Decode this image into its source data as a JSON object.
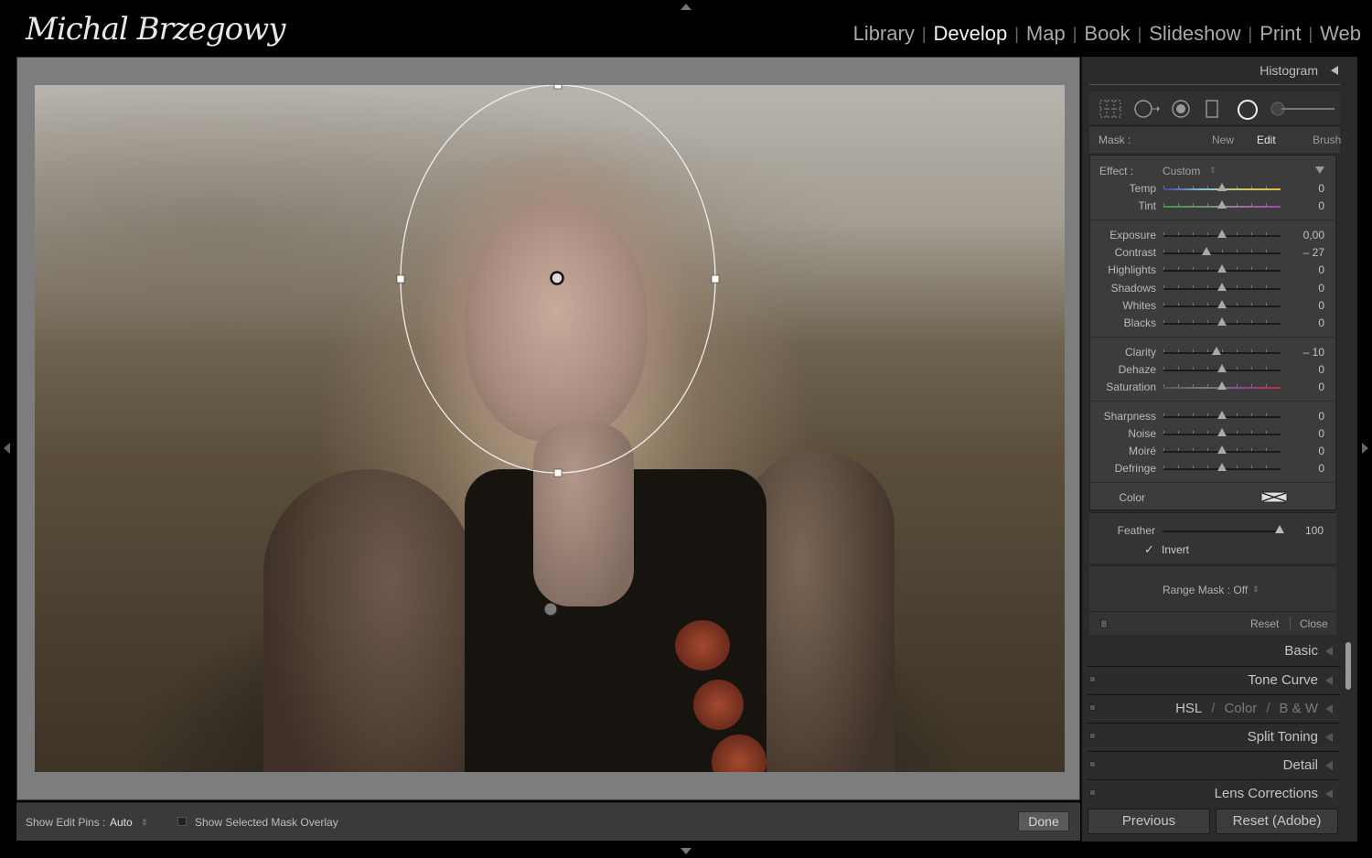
{
  "identity_plate": "Michal Brzegowy",
  "modules": [
    {
      "label": "Library",
      "active": false
    },
    {
      "label": "Develop",
      "active": true
    },
    {
      "label": "Map",
      "active": false
    },
    {
      "label": "Book",
      "active": false
    },
    {
      "label": "Slideshow",
      "active": false
    },
    {
      "label": "Print",
      "active": false
    },
    {
      "label": "Web",
      "active": false
    }
  ],
  "module_separator": "|",
  "toolbar": {
    "show_edit_pins_label": "Show Edit Pins :",
    "show_edit_pins_value": "Auto",
    "show_mask_overlay_label": "Show Selected Mask Overlay",
    "done_label": "Done"
  },
  "histogram": {
    "title": "Histogram"
  },
  "tools": [
    "crop-overlay-icon",
    "spot-removal-icon",
    "red-eye-icon",
    "graduated-filter-icon",
    "radial-filter-icon",
    "adjustment-brush-icon"
  ],
  "mask": {
    "label": "Mask :",
    "new": "New",
    "edit": "Edit",
    "brush": "Brush"
  },
  "effect": {
    "label": "Effect :",
    "value": "Custom"
  },
  "sliders": {
    "group1": [
      {
        "name": "Temp",
        "value": "0",
        "pos": 0.5
      },
      {
        "name": "Tint",
        "value": "0",
        "pos": 0.5
      }
    ],
    "group2": [
      {
        "name": "Exposure",
        "value": "0,00",
        "pos": 0.5
      },
      {
        "name": "Contrast",
        "value": "– 27",
        "pos": 0.37
      },
      {
        "name": "Highlights",
        "value": "0",
        "pos": 0.5
      },
      {
        "name": "Shadows",
        "value": "0",
        "pos": 0.5
      },
      {
        "name": "Whites",
        "value": "0",
        "pos": 0.5
      },
      {
        "name": "Blacks",
        "value": "0",
        "pos": 0.5
      }
    ],
    "group3": [
      {
        "name": "Clarity",
        "value": "– 10",
        "pos": 0.45
      },
      {
        "name": "Dehaze",
        "value": "0",
        "pos": 0.5
      },
      {
        "name": "Saturation",
        "value": "0",
        "pos": 0.5
      }
    ],
    "group4": [
      {
        "name": "Sharpness",
        "value": "0",
        "pos": 0.5
      },
      {
        "name": "Noise",
        "value": "0",
        "pos": 0.5
      },
      {
        "name": "Moiré",
        "value": "0",
        "pos": 0.5
      },
      {
        "name": "Defringe",
        "value": "0",
        "pos": 0.5
      }
    ]
  },
  "color_label": "Color",
  "feather": {
    "label": "Feather",
    "value": "100",
    "pos": 1.0
  },
  "invert": {
    "label": "Invert",
    "checked": true,
    "mark": "✓"
  },
  "range_mask": {
    "label": "Range Mask : Off"
  },
  "reset_label": "Reset",
  "close_label": "Close",
  "panels": {
    "basic": "Basic",
    "tone_curve": "Tone Curve",
    "hsl": "HSL",
    "hsl_sep": "/",
    "color": "Color",
    "bw": "B & W",
    "split_toning": "Split Toning",
    "detail": "Detail",
    "lens_corrections": "Lens Corrections"
  },
  "buttons": {
    "previous": "Previous",
    "reset_adobe": "Reset (Adobe)"
  },
  "colors": {
    "accent_text": "#f2f2f2",
    "panel_bg": "#3c3c3c",
    "center_bg": "#7d7d7d"
  }
}
